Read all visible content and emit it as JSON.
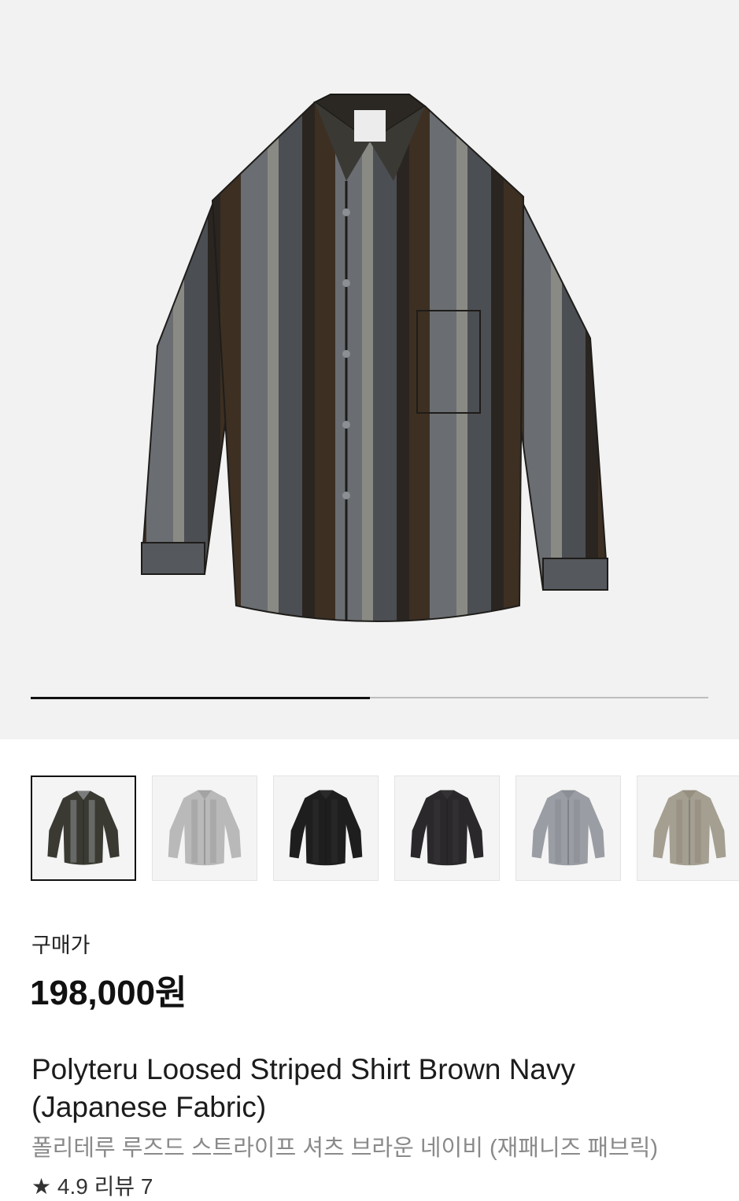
{
  "hero": {
    "image_name": "striped-shirt-main-image",
    "progress_fraction": 0.5
  },
  "thumbnails": [
    {
      "name": "thumb-brown-navy-stripe",
      "colors": {
        "body": "#3a3a33",
        "stripe": "#7a7d7c"
      },
      "selected": true
    },
    {
      "name": "thumb-light-grey",
      "colors": {
        "body": "#b9b9b9",
        "stripe": "#a3a3a3"
      },
      "selected": false
    },
    {
      "name": "thumb-black",
      "colors": {
        "body": "#1e1e1e",
        "stripe": "#2a2a2a"
      },
      "selected": false
    },
    {
      "name": "thumb-charcoal",
      "colors": {
        "body": "#2b282b",
        "stripe": "#353235"
      },
      "selected": false
    },
    {
      "name": "thumb-blue-grey",
      "colors": {
        "body": "#9a9da4",
        "stripe": "#8b8e95"
      },
      "selected": false
    },
    {
      "name": "thumb-khaki",
      "colors": {
        "body": "#a49f91",
        "stripe": "#958f80"
      },
      "selected": false
    }
  ],
  "product": {
    "price_label": "구매가",
    "price": "198,000원",
    "title_en_line1": "Polyteru Loosed Striped Shirt Brown Navy",
    "title_en_line2": "(Japanese Fabric)",
    "title_ko": "폴리테루 루즈드 스트라이프 셔츠 브라운 네이비 (재패니즈 패브릭)",
    "rating_partial": "★ 4.9  리뷰 7"
  },
  "colors": {
    "hero_bg": "#f2f2f2",
    "accent_dark": "#111111",
    "subtitle_grey": "#8a8a8a"
  }
}
